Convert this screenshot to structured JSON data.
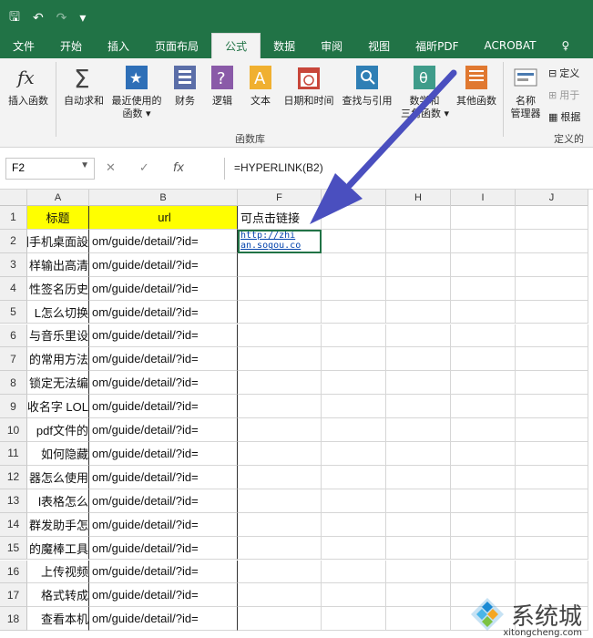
{
  "qat": {
    "save": "🖫",
    "undo": "↶",
    "redo": "↷",
    "more": "▾"
  },
  "tabs": [
    "文件",
    "开始",
    "插入",
    "页面布局",
    "公式",
    "数据",
    "审阅",
    "视图",
    "福昕PDF",
    "ACROBAT",
    "♀"
  ],
  "active_tab": "公式",
  "ribbon": {
    "buttons": [
      {
        "label1": "插入函数",
        "label2": "",
        "icon": "fx-icon"
      },
      {
        "label1": "自动求和",
        "label2": "",
        "icon": "sigma-icon"
      },
      {
        "label1": "最近使用的",
        "label2": "函数 ▾",
        "icon": "star-icon"
      },
      {
        "label1": "财务",
        "label2": "",
        "icon": "finance-icon"
      },
      {
        "label1": "逻辑",
        "label2": "",
        "icon": "question-icon"
      },
      {
        "label1": "文本",
        "label2": "",
        "icon": "text-icon"
      },
      {
        "label1": "日期和时间",
        "label2": "",
        "icon": "calendar-icon"
      },
      {
        "label1": "查找与引用",
        "label2": "",
        "icon": "lookup-icon"
      },
      {
        "label1": "数学和",
        "label2": "三角函数 ▾",
        "icon": "math-icon"
      },
      {
        "label1": "其他函数",
        "label2": "",
        "icon": "more-functions-icon"
      },
      {
        "label1": "名称",
        "label2": "管理器",
        "icon": "name-manager-icon"
      }
    ],
    "group_label": "函数库",
    "side_items": [
      "定义",
      "用于",
      "根据"
    ],
    "side_group_label": "定义的"
  },
  "formula_bar": {
    "name_box": "F2",
    "cancel": "✕",
    "enter": "✓",
    "fx": "fx",
    "formula": "=HYPERLINK(B2)"
  },
  "columns": [
    "A",
    "B",
    "F",
    "G",
    "H",
    "I",
    "J"
  ],
  "header_row": {
    "A": "标题",
    "B": "url",
    "F": "可点击链接"
  },
  "rows": [
    {
      "num": "1"
    },
    {
      "num": "2",
      "A": "图手机桌面設",
      "B": "om/guide/detail/?id=",
      "F1": "http://zhi",
      "F2": "an.sogou.co"
    },
    {
      "num": "3",
      "A": "样输出高清",
      "B": "om/guide/detail/?id="
    },
    {
      "num": "4",
      "A": "性签名历史",
      "B": "om/guide/detail/?id="
    },
    {
      "num": "5",
      "A": "L怎么切换",
      "B": "om/guide/detail/?id="
    },
    {
      "num": "6",
      "A": "与音乐里设",
      "B": "om/guide/detail/?id="
    },
    {
      "num": "7",
      "A": "的常用方法",
      "B": "om/guide/detail/?id="
    },
    {
      "num": "8",
      "A": "锁定无法编",
      "B": "om/guide/detail/?id="
    },
    {
      "num": "9",
      "A": "收名字 LOL",
      "B": "om/guide/detail/?id="
    },
    {
      "num": "10",
      "A": "pdf文件的",
      "B": "om/guide/detail/?id="
    },
    {
      "num": "11",
      "A": "如何隐藏",
      "B": "om/guide/detail/?id="
    },
    {
      "num": "12",
      "A": "器怎么使用",
      "B": "om/guide/detail/?id="
    },
    {
      "num": "13",
      "A": "l表格怎么",
      "B": "om/guide/detail/?id="
    },
    {
      "num": "14",
      "A": "群发助手怎",
      "B": "om/guide/detail/?id="
    },
    {
      "num": "15",
      "A": "的魔棒工具",
      "B": "om/guide/detail/?id="
    },
    {
      "num": "16",
      "A": "上传视频",
      "B": "om/guide/detail/?id="
    },
    {
      "num": "17",
      "A": "格式转成",
      "B": "om/guide/detail/?id="
    },
    {
      "num": "18",
      "A": "查看本机",
      "B": "om/guide/detail/?id="
    }
  ],
  "watermark": {
    "main": "系统城",
    "sub": "xitongcheng.com"
  },
  "colors": {
    "excel_green": "#217346",
    "yellow_header": "#ffff00",
    "arrow": "#4a4fbf",
    "link": "#0645ad"
  }
}
